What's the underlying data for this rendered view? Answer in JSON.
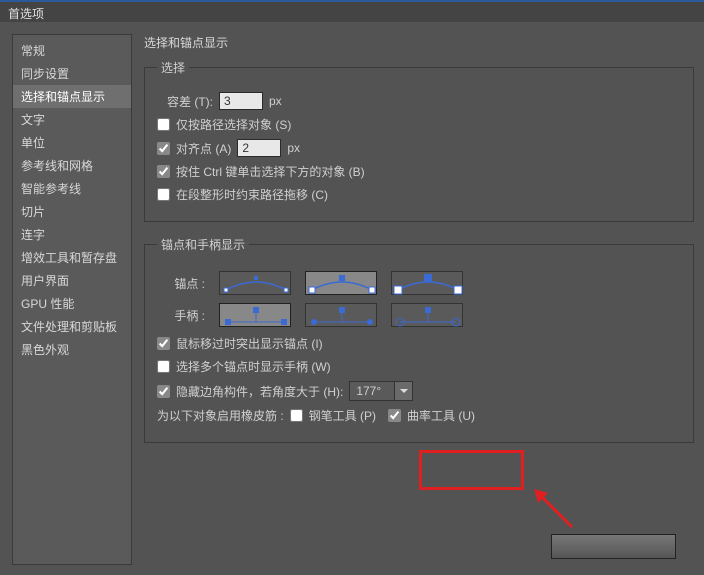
{
  "window": {
    "title": "首选项"
  },
  "sidebar": {
    "items": [
      {
        "label": "常规"
      },
      {
        "label": "同步设置"
      },
      {
        "label": "选择和锚点显示",
        "selected": true
      },
      {
        "label": "文字"
      },
      {
        "label": "单位"
      },
      {
        "label": "参考线和网格"
      },
      {
        "label": "智能参考线"
      },
      {
        "label": "切片"
      },
      {
        "label": "连字"
      },
      {
        "label": "增效工具和暂存盘"
      },
      {
        "label": "用户界面"
      },
      {
        "label": "GPU 性能"
      },
      {
        "label": "文件处理和剪贴板"
      },
      {
        "label": "黑色外观"
      }
    ]
  },
  "content": {
    "title": "选择和锚点显示",
    "selectGroup": {
      "legend": "选择",
      "tolerance_label": "容差 (T):",
      "tolerance_value": "3",
      "tolerance_unit": "px",
      "cb_path_only": {
        "checked": false,
        "label": "仅按路径选择对象 (S)"
      },
      "cb_snap": {
        "checked": true,
        "label": "对齐点 (A)"
      },
      "snap_value": "2",
      "snap_unit": "px",
      "cb_ctrl_under": {
        "checked": true,
        "label": "按住 Ctrl 键单击选择下方的对象 (B)"
      },
      "cb_constrain": {
        "checked": false,
        "label": "在段整形时约束路径拖移 (C)"
      }
    },
    "anchorGroup": {
      "legend": "锚点和手柄显示",
      "anchors_label": "锚点 :",
      "handles_label": "手柄 :",
      "cb_highlight": {
        "checked": true,
        "label": "鼠标移过时突出显示锚点 (I)"
      },
      "cb_multi_handles": {
        "checked": false,
        "label": "选择多个锚点时显示手柄 (W)"
      },
      "cb_hide_corner": {
        "checked": true,
        "label": "隐藏边角构件，若角度大于 (H):"
      },
      "angle_value": "177°",
      "rubber_label": "为以下对象启用橡皮筋 :",
      "cb_pen": {
        "checked": false,
        "label": "钢笔工具 (P)"
      },
      "cb_curv": {
        "checked": true,
        "label": "曲率工具 (U)"
      }
    }
  }
}
